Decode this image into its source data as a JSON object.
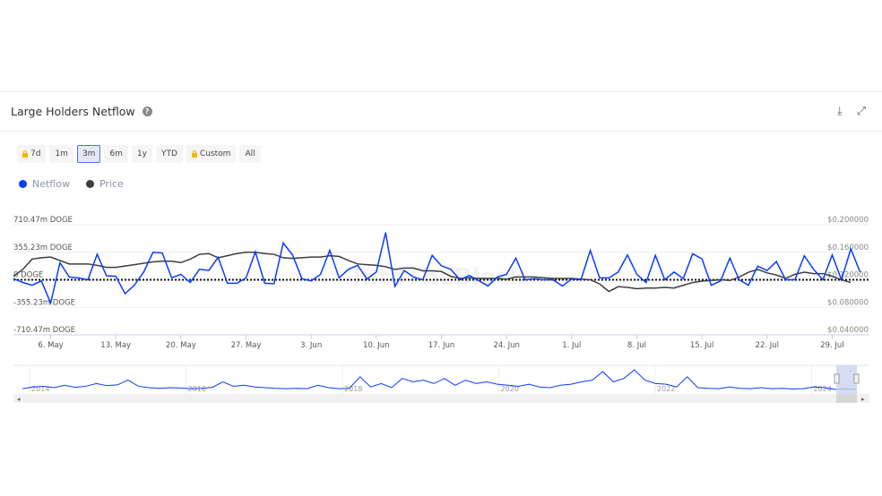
{
  "header": {
    "title": "Large Holders Netflow",
    "help_icon": "question-circle-icon",
    "download_icon": "download-icon",
    "fullscreen_icon": "expand-icon"
  },
  "ranges": [
    {
      "label": "7d",
      "locked": true
    },
    {
      "label": "1m"
    },
    {
      "label": "3m",
      "active": true
    },
    {
      "label": "6m"
    },
    {
      "label": "1y"
    },
    {
      "label": "YTD"
    },
    {
      "label": "Custom",
      "locked": true
    },
    {
      "label": "All"
    }
  ],
  "legend": [
    {
      "label": "Netflow",
      "color": "#0a3cff"
    },
    {
      "label": "Price",
      "color": "#3d3d3d"
    }
  ],
  "watermark": "IntoTheBlock",
  "chart_data": {
    "type": "line",
    "start_date": "2024-05-02",
    "x_ticks": [
      "6. May",
      "13. May",
      "20. May",
      "27. May",
      "3. Jun",
      "10. Jun",
      "17. Jun",
      "24. Jun",
      "1. Jul",
      "8. Jul",
      "15. Jul",
      "22. Jul",
      "29. Jul"
    ],
    "y_left": {
      "ticks": [
        "710.47m DOGE",
        "355.23m DOGE",
        "0 DOGE",
        "-355.23m DOGE",
        "-710.47m DOGE"
      ],
      "range": [
        -710.47,
        710.47
      ],
      "unit": "m DOGE"
    },
    "y_right": {
      "ticks": [
        "$0.200000",
        "$0.160000",
        "$0.120000",
        "$0.080000",
        "$0.040000"
      ],
      "range": [
        0.04,
        0.2
      ]
    },
    "grid": true,
    "series": [
      {
        "name": "Netflow",
        "color": "#0a3cff",
        "values": [
          15,
          -35,
          -70,
          -15,
          -300,
          220,
          35,
          25,
          0,
          330,
          50,
          45,
          -180,
          -70,
          100,
          355,
          345,
          25,
          70,
          -35,
          135,
          120,
          290,
          -45,
          -45,
          25,
          360,
          -45,
          -50,
          475,
          320,
          15,
          -15,
          70,
          380,
          25,
          135,
          185,
          10,
          100,
          610,
          -85,
          120,
          35,
          0,
          315,
          180,
          135,
          0,
          55,
          -10,
          -80,
          35,
          70,
          280,
          0,
          15,
          0,
          0,
          -80,
          10,
          0,
          380,
          25,
          25,
          100,
          320,
          70,
          -35,
          315,
          0,
          100,
          15,
          335,
          270,
          -70,
          -15,
          280,
          0,
          -70,
          175,
          120,
          235,
          0,
          0,
          310,
          135,
          0,
          320,
          0,
          400,
          100
        ]
      },
      {
        "name": "Price",
        "color": "#3d3d3d",
        "values": [
          0.125,
          0.135,
          0.15,
          0.152,
          0.153,
          0.148,
          0.143,
          0.143,
          0.143,
          0.141,
          0.138,
          0.138,
          0.14,
          0.142,
          0.144,
          0.146,
          0.147,
          0.147,
          0.145,
          0.15,
          0.157,
          0.158,
          0.152,
          0.155,
          0.158,
          0.16,
          0.16,
          0.158,
          0.157,
          0.152,
          0.151,
          0.152,
          0.153,
          0.153,
          0.155,
          0.154,
          0.148,
          0.143,
          0.142,
          0.141,
          0.139,
          0.135,
          0.137,
          0.137,
          0.133,
          0.133,
          0.132,
          0.125,
          0.122,
          0.123,
          0.122,
          0.122,
          0.122,
          0.121,
          0.124,
          0.124,
          0.124,
          0.123,
          0.122,
          0.122,
          0.122,
          0.121,
          0.12,
          0.114,
          0.103,
          0.11,
          0.109,
          0.107,
          0.108,
          0.108,
          0.109,
          0.108,
          0.112,
          0.116,
          0.118,
          0.119,
          0.12,
          0.119,
          0.124,
          0.131,
          0.135,
          0.13,
          0.127,
          0.122,
          0.128,
          0.131,
          0.129,
          0.129,
          0.125,
          0.12,
          0.116
        ]
      }
    ],
    "navigator": {
      "labels": [
        "2014",
        "2016",
        "2018",
        "2020",
        "2022",
        "2024"
      ],
      "values": [
        5,
        10,
        12,
        8,
        15,
        9,
        12,
        20,
        14,
        16,
        30,
        12,
        8,
        6,
        8,
        7,
        5,
        6,
        9,
        25,
        12,
        15,
        10,
        8,
        6,
        5,
        6,
        5,
        15,
        8,
        5,
        6,
        40,
        10,
        20,
        8,
        35,
        25,
        30,
        20,
        35,
        15,
        30,
        20,
        25,
        18,
        15,
        12,
        18,
        10,
        8,
        15,
        18,
        25,
        30,
        55,
        25,
        35,
        60,
        30,
        20,
        18,
        10,
        40,
        8,
        6,
        5,
        10,
        6,
        5,
        8,
        5,
        6,
        4,
        5,
        10,
        8,
        3,
        4,
        3
      ]
    }
  }
}
